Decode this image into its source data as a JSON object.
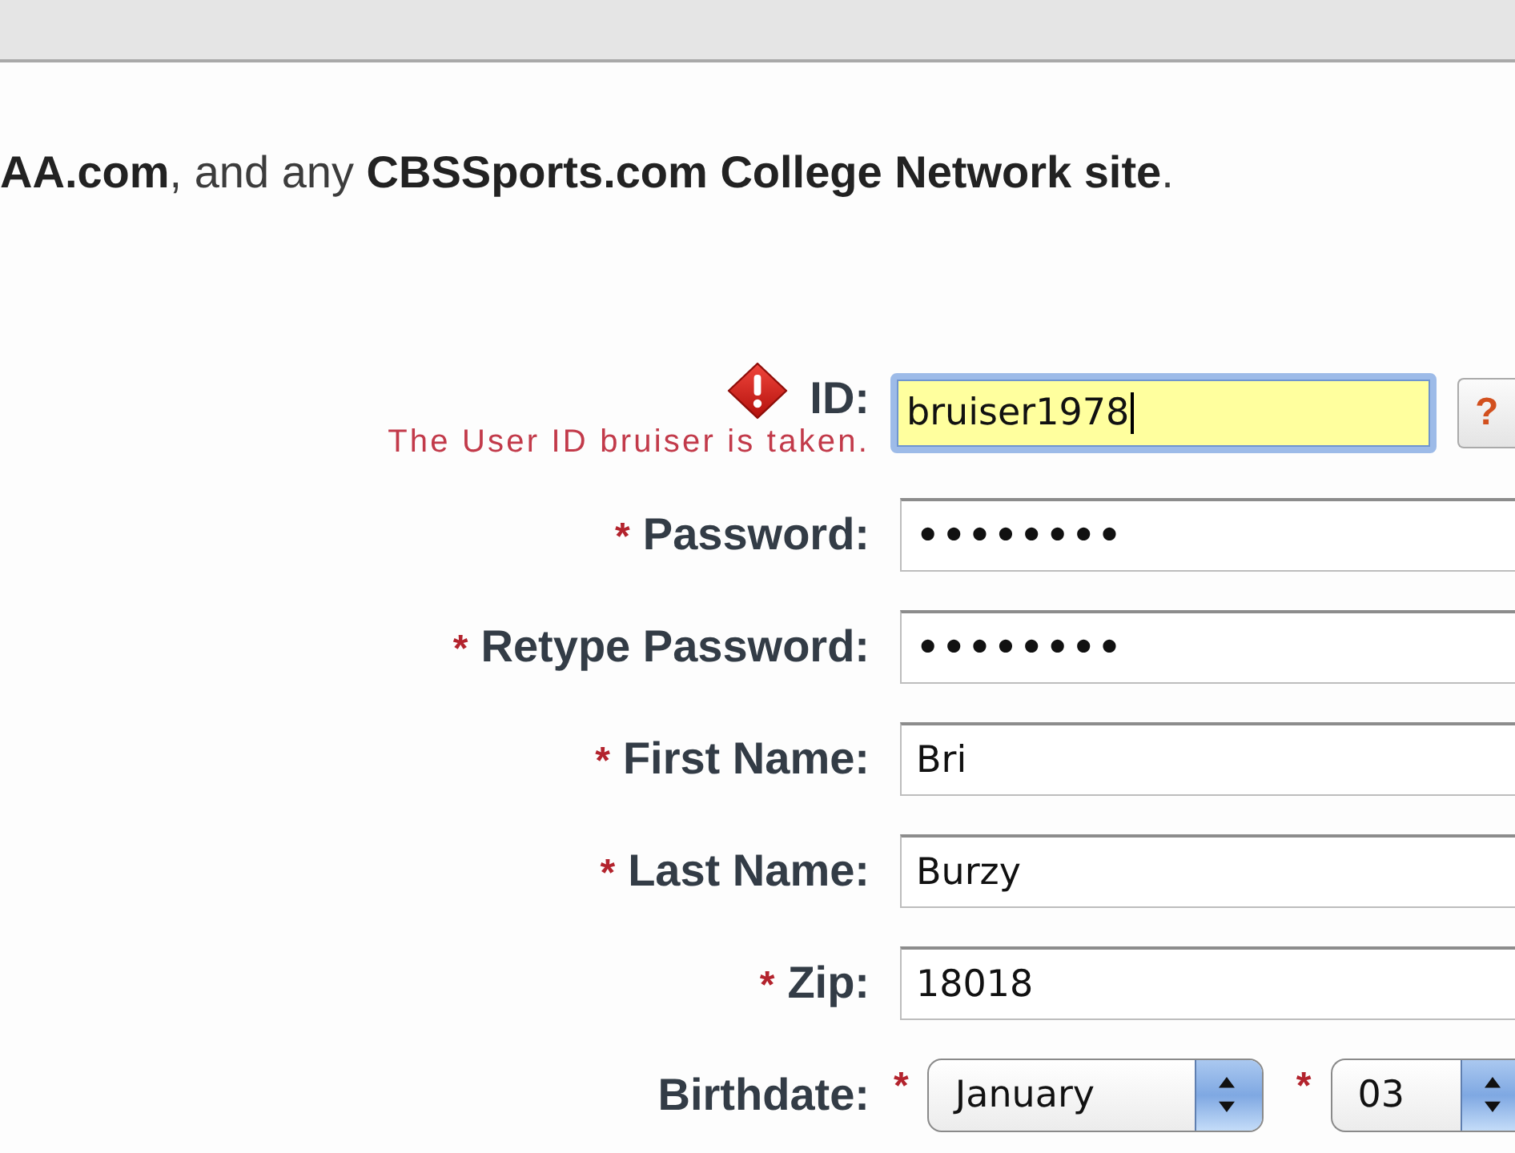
{
  "notice": "**AA.com**, and any **CBSSports.com College Network site**.",
  "fields": [
    {
      "kind": "text",
      "label": "ID:",
      "value": "bruiser1978",
      "focused": true,
      "error": "The User ID bruiser is taken.",
      "help_button": "?"
    },
    {
      "kind": "password",
      "label": "Password:",
      "required_mark": "*",
      "value": "••••••••",
      "focused": false
    },
    {
      "kind": "password",
      "label": "Retype Password:",
      "required_mark": "*",
      "value": "••••••••",
      "focused": false
    },
    {
      "kind": "text",
      "label": "First Name:",
      "required_mark": "*",
      "value": "Bri",
      "focused": false
    },
    {
      "kind": "text",
      "label": "Last Name:",
      "required_mark": "*",
      "value": "Burzy",
      "focused": false
    },
    {
      "kind": "text",
      "label": "Zip:",
      "required_mark": "*",
      "value": "18018",
      "focused": false
    }
  ],
  "birthdate": {
    "label": "Birthdate:",
    "selects": [
      {
        "kind": "month",
        "required_mark": "*",
        "value": "January"
      },
      {
        "kind": "day",
        "required_mark": "*",
        "value": "03"
      }
    ]
  }
}
